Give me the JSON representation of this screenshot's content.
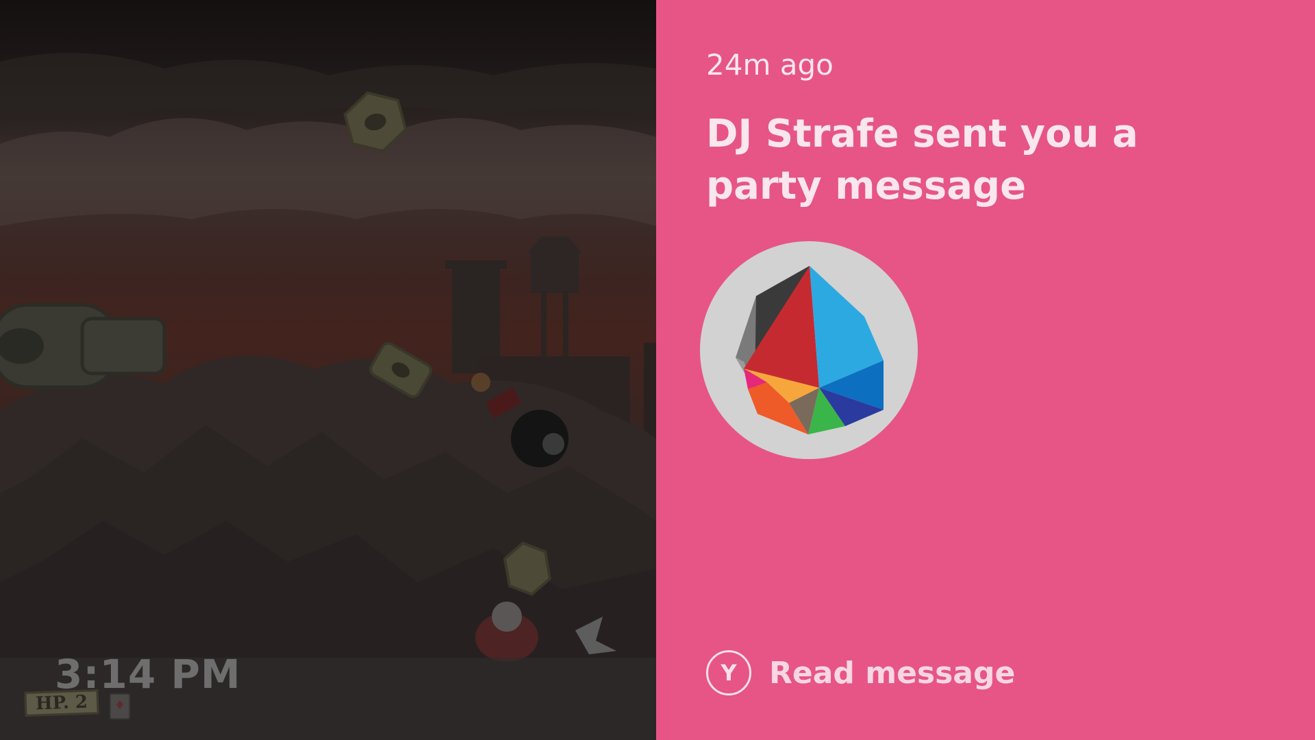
{
  "game": {
    "clock": "3:14 PM",
    "hp_label": "HP. 2"
  },
  "notification": {
    "timestamp": "24m ago",
    "title": "DJ Strafe sent you a party message",
    "avatar_icon": "gamerpic-crystal-icon",
    "background_color": "#e65585",
    "action": {
      "button_glyph": "Y",
      "label": "Read message"
    }
  }
}
